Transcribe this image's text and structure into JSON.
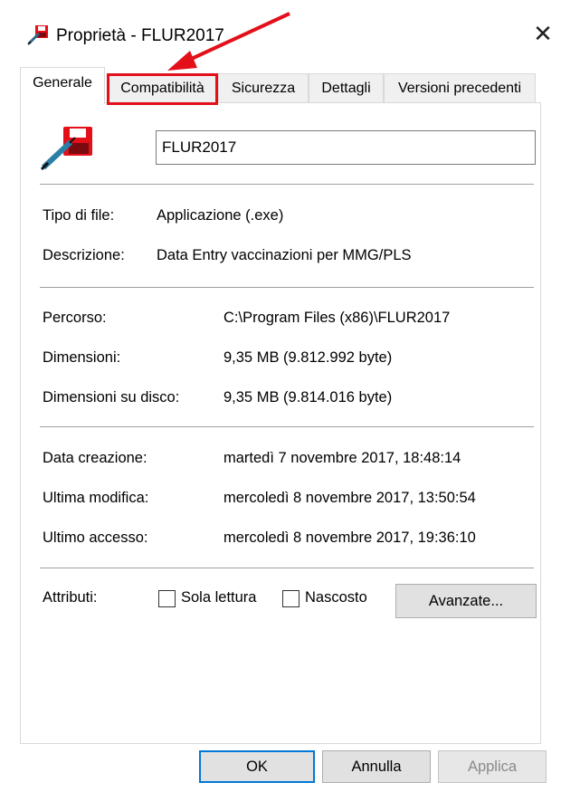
{
  "window": {
    "title": "Proprietà - FLUR2017",
    "close_glyph": "✕"
  },
  "tabs": [
    {
      "label": "Generale",
      "active": true
    },
    {
      "label": "Compatibilità",
      "active": false,
      "highlighted": true
    },
    {
      "label": "Sicurezza",
      "active": false
    },
    {
      "label": "Dettagli",
      "active": false
    },
    {
      "label": "Versioni precedenti",
      "active": false
    }
  ],
  "file": {
    "name": "FLUR2017",
    "icon": "syringe-floppy-icon",
    "tipo_label": "Tipo di file:",
    "tipo_value": "Applicazione (.exe)",
    "descr_label": "Descrizione:",
    "descr_value": "Data Entry vaccinazioni per MMG/PLS"
  },
  "location": {
    "percorso_label": "Percorso:",
    "percorso_value": "C:\\Program Files (x86)\\FLUR2017",
    "dim_label": "Dimensioni:",
    "dim_value": "9,35 MB (9.812.992 byte)",
    "disco_label": "Dimensioni su disco:",
    "disco_value": "9,35 MB (9.814.016 byte)"
  },
  "dates": {
    "creazione_label": "Data creazione:",
    "creazione_value": "martedì 7 novembre 2017, 18:48:14",
    "modifica_label": "Ultima modifica:",
    "modifica_value": "mercoledì 8 novembre 2017, 13:50:54",
    "accesso_label": "Ultimo accesso:",
    "accesso_value": "mercoledì 8 novembre 2017, 19:36:10"
  },
  "attributes": {
    "label": "Attributi:",
    "readonly_label": "Sola lettura",
    "readonly_checked": false,
    "hidden_label": "Nascosto",
    "hidden_checked": false,
    "advanced_label": "Avanzate..."
  },
  "footer": {
    "ok_label": "OK",
    "cancel_label": "Annulla",
    "apply_label": "Applica",
    "apply_enabled": false
  },
  "annotation": {
    "color": "#e3101a",
    "target": "Compatibilità"
  },
  "colors": {
    "accent": "#0078d7",
    "annotation_red": "#e3101a"
  }
}
